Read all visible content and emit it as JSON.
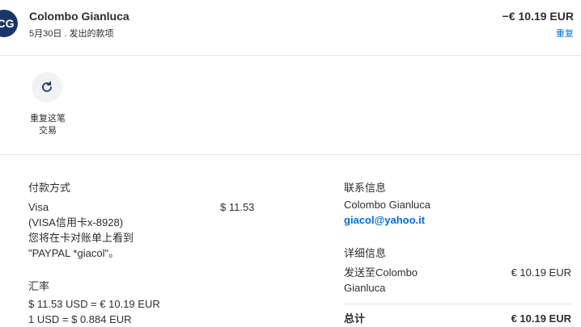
{
  "header": {
    "avatar_initials": "CG",
    "name": "Colombo Gianluca",
    "subtitle": "5月30日 . 发出的款项",
    "amount": "−€ 10.19 EUR",
    "repeat_link": "重复"
  },
  "actions": {
    "repeat_label_line1": "重复这笔",
    "repeat_label_line2": "交易",
    "repeat_icon": "refresh-icon"
  },
  "payment": {
    "heading": "付款方式",
    "method": "Visa",
    "card_line": "(VISA信用卡x-8928)",
    "statement_line1": "您将在卡对账单上看到",
    "statement_line2": "\"PAYPAL *giacol\"。",
    "amount": "$ 11.53"
  },
  "exchange": {
    "heading": "汇率",
    "line1": "$ 11.53 USD = € 10.19 EUR",
    "line2": "1 USD = $ 0.884 EUR"
  },
  "contact": {
    "heading": "联系信息",
    "name": "Colombo Gianluca",
    "email": "giacol@yahoo.it"
  },
  "details": {
    "heading": "详细信息",
    "send_to_line1": "发送至Colombo",
    "send_to_line2": "Gianluca",
    "send_amount": "€ 10.19 EUR",
    "total_label": "总计",
    "total_amount": "€ 10.19 EUR"
  },
  "colors": {
    "link": "#0070e0",
    "avatar_bg": "#1c3567",
    "text": "#2c2e2f"
  }
}
